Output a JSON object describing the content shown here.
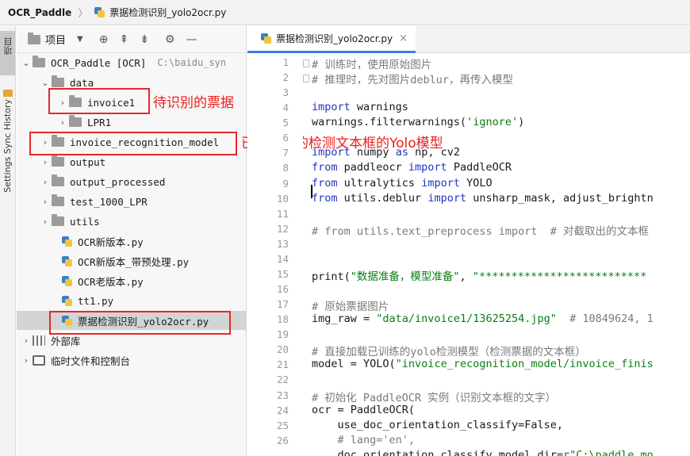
{
  "breadcrumb": {
    "project": "OCR_Paddle",
    "file": "票据检测识别_yolo2ocr.py"
  },
  "tool_strip": {
    "project_tab": "项目",
    "side_tabs": "Settings Sync History"
  },
  "panel": {
    "title": "项目"
  },
  "tree": [
    {
      "label": "OCR_Paddle [OCR]",
      "hint": "C:\\baidu_syn"
    },
    {
      "label": "data"
    },
    {
      "label": "invoice1"
    },
    {
      "label": "LPR1"
    },
    {
      "label": "invoice_recognition_model"
    },
    {
      "label": "output"
    },
    {
      "label": "output_processed"
    },
    {
      "label": "test_1000_LPR"
    },
    {
      "label": "utils"
    },
    {
      "label": "OCR新版本.py"
    },
    {
      "label": "OCR新版本_带预处理.py"
    },
    {
      "label": "OCR老版本.py"
    },
    {
      "label": "tt1.py"
    },
    {
      "label": "票据检测识别_yolo2ocr.py"
    },
    {
      "label": "外部库"
    },
    {
      "label": "临时文件和控制台"
    }
  ],
  "annotations": {
    "invoice_note": "待识别的票据",
    "model_note": "已训练好的检测文本框的Yolo模型"
  },
  "editor": {
    "tab_label": "票据检测识别_yolo2ocr.py",
    "tab_close": "×",
    "line_numbers": [
      "1",
      "2",
      "3",
      "4",
      "5",
      "6",
      "7",
      "8",
      "9",
      "10",
      "11",
      "12",
      "13",
      "14",
      "15",
      "16",
      "17",
      "18",
      "19",
      "20",
      "21",
      "22",
      "23",
      "24",
      "25",
      "26"
    ],
    "lines": [
      "# 训练时，使用原始图片",
      "# 推理时，先对图片deblur，再传入模型",
      "",
      "import warnings",
      "warnings.filterwarnings('ignore')",
      "",
      "import numpy as np, cv2",
      "from paddleocr import PaddleOCR",
      "from ultralytics import YOLO",
      "from utils.deblur import unsharp_mask, adjust_brightn",
      "",
      "# from utils.text_preprocess import  # 对截取出的文本框",
      "",
      "",
      "print(\"数据准备，模型准备\", \"**************************",
      "",
      "# 原始票据图片",
      "img_raw = \"data/invoice1/13625254.jpg\"  # 10849624, 1",
      "",
      "# 直接加载已训练的yolo检测模型（检测票据的文本框）",
      "model = YOLO(\"invoice_recognition_model/invoice_finis",
      "",
      "# 初始化 PaddleOCR 实例（识别文本框的文字）",
      "ocr = PaddleOCR(",
      "    use_doc_orientation_classify=False,",
      "    # lang='en',",
      "    doc_orientation_classify_model_dir=r\"C:\\paddle_mo"
    ]
  },
  "colors": {
    "keyword": "#1f35c2",
    "string": "#0a7d16",
    "comment": "#7a7a7a",
    "annotation_red": "#ee1c1c",
    "accent": "#3d7ee1"
  },
  "icons": [
    "python-file-icon",
    "folder-icon",
    "library-icon",
    "target-icon",
    "collapse-icon",
    "expand-icon",
    "gear-icon",
    "minus-icon"
  ]
}
